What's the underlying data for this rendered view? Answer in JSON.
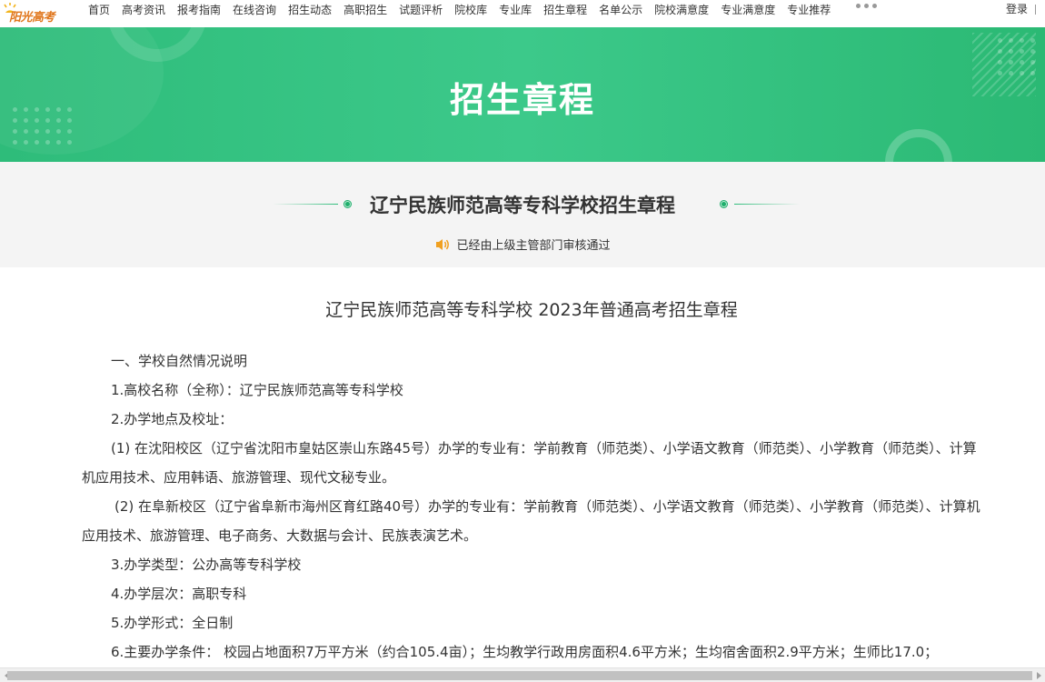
{
  "logo": {
    "text": "阳光高考"
  },
  "nav": {
    "items": [
      "首页",
      "高考资讯",
      "报考指南",
      "在线咨询",
      "招生动态",
      "高职招生",
      "试题评析",
      "院校库",
      "专业库",
      "招生章程",
      "名单公示",
      "院校满意度",
      "专业满意度",
      "专业推荐"
    ],
    "more_icon": "more-dots-icon",
    "login_label": "登录"
  },
  "banner": {
    "title": "招生章程"
  },
  "title_section": {
    "school_title": "辽宁民族师范高等专科学校招生章程",
    "approval_text": "已经由上级主管部门审核通过",
    "approval_icon": "speaker-icon"
  },
  "document": {
    "heading": "辽宁民族师范高等专科学校 2023年普通高考招生章程",
    "paragraphs": [
      "一、学校自然情况说明",
      "1.高校名称（全称）：辽宁民族师范高等专科学校",
      "2.办学地点及校址：",
      "(1) 在沈阳校区（辽宁省沈阳市皇姑区崇山东路45号）办学的专业有：学前教育（师范类）、小学语文教育（师范类）、小学教育（师范类）、计算机应用技术、应用韩语、旅游管理、现代文秘专业。",
      " (2) 在阜新校区（辽宁省阜新市海州区育红路40号）办学的专业有：学前教育（师范类）、小学语文教育（师范类）、小学教育（师范类）、计算机应用技术、旅游管理、电子商务、大数据与会计、民族表演艺术。",
      "3.办学类型：公办高等专科学校",
      "4.办学层次：高职专科",
      "5.办学形式：全日制",
      "6.主要办学条件： 校园占地面积7万平方米（约合105.4亩）；生均教学行政用房面积4.6平方米；生均宿舍面积2.9平方米；生师比17.0；"
    ]
  },
  "colors": {
    "brand_green": "#2ebc7a",
    "logo_orange": "#e0761c",
    "speaker_orange": "#f0a020"
  }
}
